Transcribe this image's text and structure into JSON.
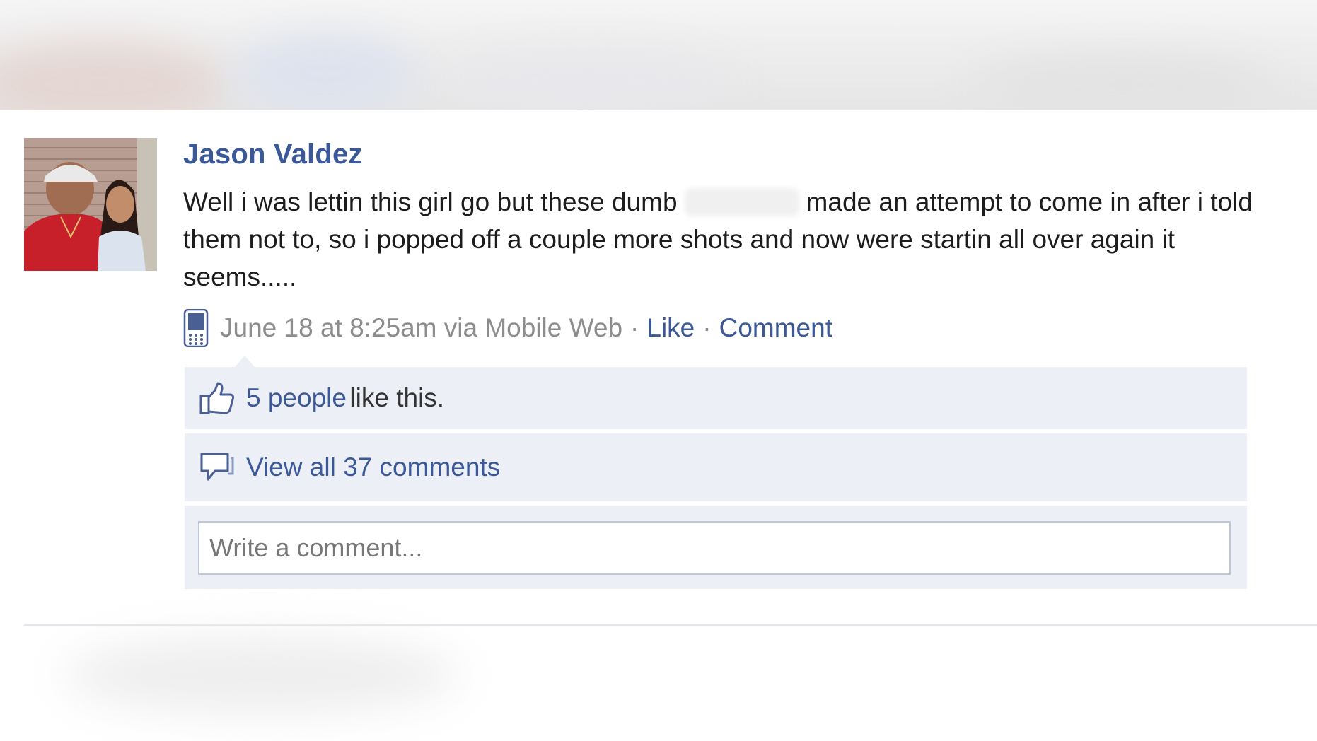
{
  "post": {
    "author": "Jason Valdez",
    "text_before": "Well i was lettin this girl go but these dumb",
    "text_after": "made an attempt to come in after i told them not to, so i popped off a couple more shots and now were startin all over again it seems.....",
    "timestamp": "June 18 at 8:25am via Mobile Web",
    "separator": "·",
    "like_label": "Like",
    "comment_label": "Comment",
    "source_icon": "mobile-phone-icon"
  },
  "ufi": {
    "likes_link": "5 people",
    "likes_suffix": "like this.",
    "likes_icon": "thumbs-up-icon",
    "view_comments": "View all 37 comments",
    "comments_icon": "speech-bubble-icon",
    "comment_placeholder": "Write a comment..."
  },
  "colors": {
    "link": "#3b5998",
    "ufi_background": "#eceff5",
    "input_border": "#bdc7d8",
    "meta_text": "#8d8d8d"
  }
}
